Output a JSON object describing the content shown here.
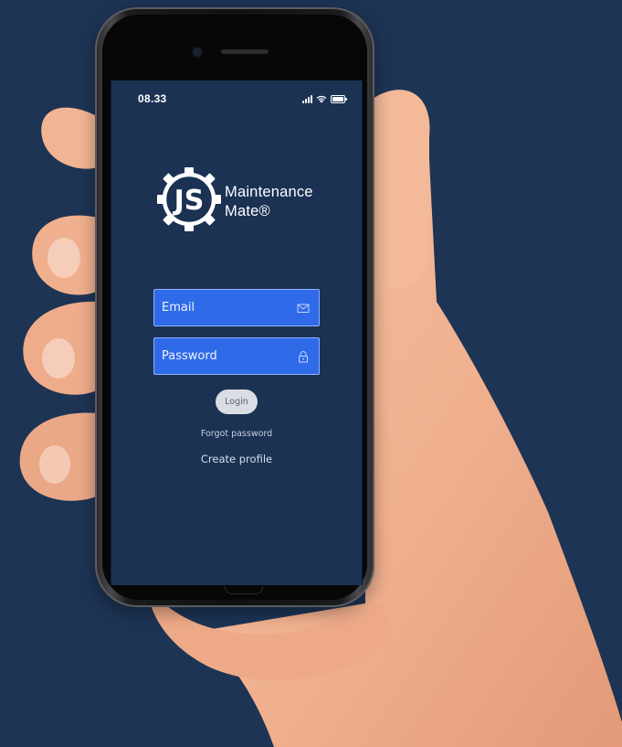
{
  "status_bar": {
    "time": "08.33"
  },
  "brand": {
    "monogram": "JS",
    "name_line1": "Maintenance",
    "name_line2": "Mate®"
  },
  "form": {
    "email_placeholder": "Email",
    "password_placeholder": "Password",
    "login_label": "Login"
  },
  "links": {
    "forgot_password": "Forgot password",
    "create_profile": "Create profile"
  },
  "icons": {
    "email": "envelope-icon",
    "password": "lock-icon",
    "signal": "cellular-signal-icon",
    "wifi": "wifi-icon",
    "battery": "battery-icon"
  },
  "colors": {
    "background": "#1d3454",
    "screen": "#1b3253",
    "field_fill": "#2f6ae8",
    "field_border": "#8fb2ff",
    "button": "#dadde3",
    "skin": "#f0b492"
  }
}
